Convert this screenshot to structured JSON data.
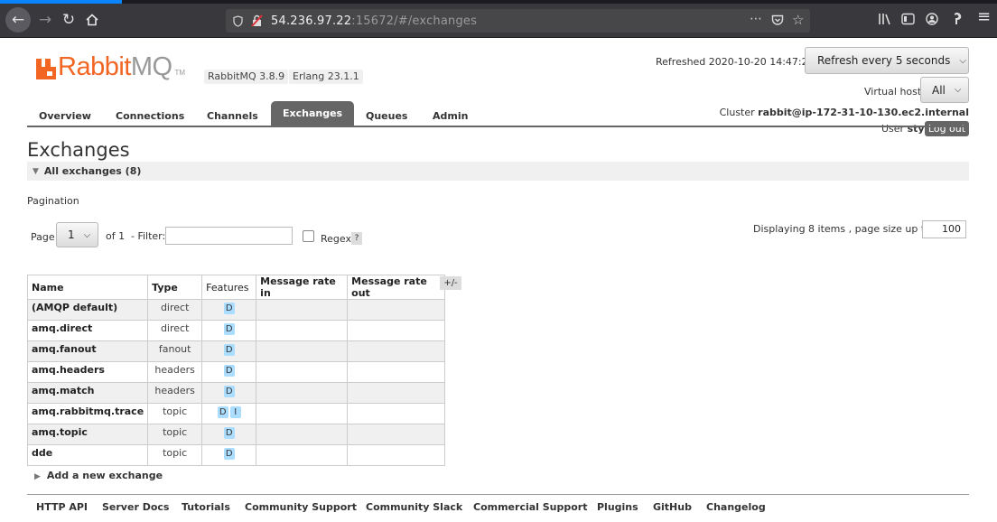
{
  "browser": {
    "url_host": "54.236.97.22",
    "url_rest": ":15672/#/exchanges",
    "back_icon": "arrow-left-icon",
    "forward_icon": "arrow-right-icon",
    "reload_icon": "reload-icon",
    "home_icon": "home-icon"
  },
  "header": {
    "logo_rabbit": "Rabbit",
    "logo_mq": "MQ",
    "logo_tm": "TM",
    "rabbitmq_version": "RabbitMQ 3.8.9",
    "erlang_version": "Erlang 23.1.1",
    "refreshed": "Refreshed 2020-10-20 14:47:29",
    "refresh_select": "Refresh every 5 seconds",
    "vhost_label": "Virtual host",
    "vhost_select": "All",
    "cluster_label": "Cluster",
    "cluster_name": "rabbit@ip-172-31-10-130.ec2.internal",
    "user_label": "User",
    "user_name": "sty",
    "logout": "Log out"
  },
  "tabs": [
    {
      "label": "Overview"
    },
    {
      "label": "Connections"
    },
    {
      "label": "Channels"
    },
    {
      "label": "Exchanges"
    },
    {
      "label": "Queues"
    },
    {
      "label": "Admin"
    }
  ],
  "main": {
    "title": "Exchanges",
    "section": "All exchanges (8)",
    "pagination_label": "Pagination",
    "page_word": "Page",
    "page_value": "1",
    "of_word": "of 1",
    "filter_word": "- Filter:",
    "regex_word": "Regex",
    "help": "?",
    "displaying": "Displaying 8 items , page size up to:",
    "page_size": "100",
    "plusminus": "+/-",
    "add_new": "Add a new exchange"
  },
  "table": {
    "headers": [
      "Name",
      "Type",
      "Features",
      "Message rate in",
      "Message rate out"
    ],
    "rows": [
      {
        "name": "(AMQP default)",
        "type": "direct",
        "features": [
          "D"
        ],
        "rate_in": "",
        "rate_out": ""
      },
      {
        "name": "amq.direct",
        "type": "direct",
        "features": [
          "D"
        ],
        "rate_in": "",
        "rate_out": ""
      },
      {
        "name": "amq.fanout",
        "type": "fanout",
        "features": [
          "D"
        ],
        "rate_in": "",
        "rate_out": ""
      },
      {
        "name": "amq.headers",
        "type": "headers",
        "features": [
          "D"
        ],
        "rate_in": "",
        "rate_out": ""
      },
      {
        "name": "amq.match",
        "type": "headers",
        "features": [
          "D"
        ],
        "rate_in": "",
        "rate_out": ""
      },
      {
        "name": "amq.rabbitmq.trace",
        "type": "topic",
        "features": [
          "D",
          "I"
        ],
        "rate_in": "",
        "rate_out": ""
      },
      {
        "name": "amq.topic",
        "type": "topic",
        "features": [
          "D"
        ],
        "rate_in": "",
        "rate_out": ""
      },
      {
        "name": "dde",
        "type": "topic",
        "features": [
          "D"
        ],
        "rate_in": "",
        "rate_out": ""
      }
    ]
  },
  "footer": [
    {
      "label": "HTTP API"
    },
    {
      "label": "Server Docs"
    },
    {
      "label": "Tutorials"
    },
    {
      "label": "Community Support"
    },
    {
      "label": "Community Slack"
    },
    {
      "label": "Commercial Support"
    },
    {
      "label": "Plugins"
    },
    {
      "label": "GitHub"
    },
    {
      "label": "Changelog"
    }
  ]
}
